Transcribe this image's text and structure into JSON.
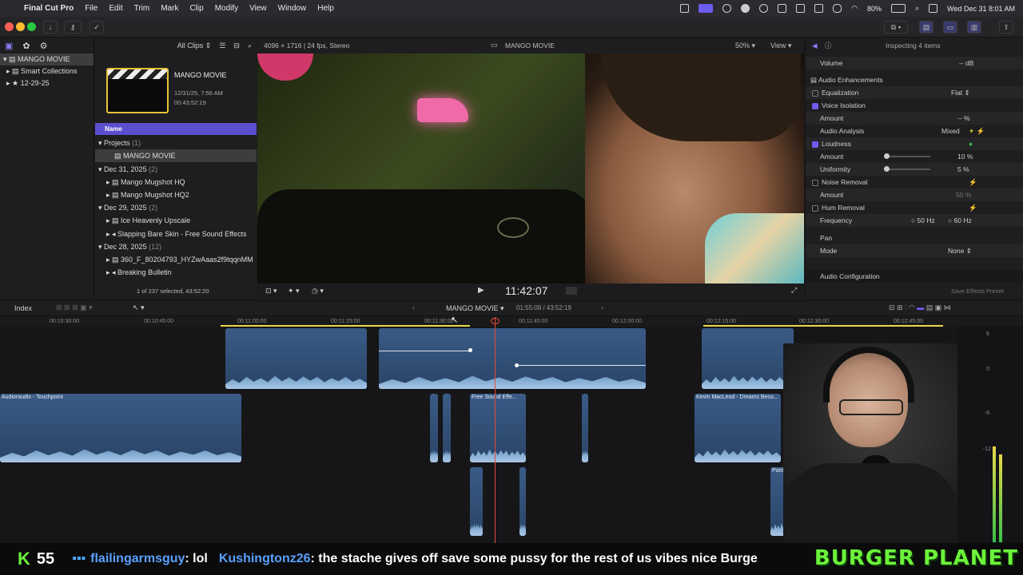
{
  "menubar": {
    "app_name": "Final Cut Pro",
    "items": [
      "File",
      "Edit",
      "Trim",
      "Mark",
      "Clip",
      "Modify",
      "View",
      "Window",
      "Help"
    ],
    "battery": "80%",
    "datetime": "Wed Dec 31  8:01 AM"
  },
  "browser": {
    "filter": "All Clips",
    "library_name": "MANGO MOVIE",
    "library_items": [
      "MANGO MOVIE",
      "Smart Collections",
      "12-29-25"
    ],
    "project_title": "MANGO MOVIE",
    "project_date": "12/31/25, 7:56 AM",
    "project_duration": "00:43:52:19",
    "column_name": "Name",
    "rows": [
      {
        "label": "Projects",
        "count": "(1)"
      },
      {
        "label": "MANGO MOVIE",
        "count": ""
      },
      {
        "label": "Dec 31, 2025",
        "count": "(2)"
      },
      {
        "label": "Mango Mugshot HQ",
        "count": ""
      },
      {
        "label": "Mango Mugshot HQ2",
        "count": ""
      },
      {
        "label": "Dec 29, 2025",
        "count": "(2)"
      },
      {
        "label": "Ice Heavenly Upscale",
        "count": ""
      },
      {
        "label": "Slapping Bare Skin - Free Sound Effects",
        "count": ""
      },
      {
        "label": "Dec 28, 2025",
        "count": "(12)"
      },
      {
        "label": "360_F_80204793_HYZwAaas2f9tqqnMM",
        "count": ""
      },
      {
        "label": "Breaking Bulletin",
        "count": ""
      }
    ],
    "selection_status": "1 of 237 selected, 43:52:20"
  },
  "viewer": {
    "format": "4096 × 1716 | 24 fps, Stereo",
    "title": "MANGO MOVIE",
    "zoom": "50%",
    "view_label": "View",
    "timecode": "11:42:07"
  },
  "inspector": {
    "header": "Inspecting 4 items",
    "volume_label": "Volume",
    "volume_value": "-- dB",
    "section": "Audio Enhancements",
    "equalization": {
      "label": "Equalization",
      "value": "Flat"
    },
    "voice_isolation": {
      "label": "Voice Isolation",
      "amount_label": "Amount",
      "amount_value": "-- %"
    },
    "audio_analysis": {
      "label": "Audio Analysis",
      "value": "Mixed"
    },
    "loudness": {
      "label": "Loudness",
      "amount_label": "Amount",
      "amount_value": "10",
      "amount_unit": "%",
      "uniformity_label": "Uniformity",
      "uniformity_value": "5",
      "uniformity_unit": "%",
      "amount_level": 0.1,
      "uniformity_level": 0.05
    },
    "noise_removal": {
      "label": "Noise Removal",
      "amount_label": "Amount",
      "amount_value": "50 %"
    },
    "hum_removal": {
      "label": "Hum Removal",
      "frequency_label": "Frequency",
      "freq_a": "50 Hz",
      "freq_b": "60 Hz"
    },
    "pan_label": "Pan",
    "mode_label": "Mode",
    "mode_value": "None",
    "audio_config": "Audio Configuration",
    "save_preset": "Save Effects Preset"
  },
  "timeline": {
    "index_label": "Index",
    "project_name": "MANGO MOVIE",
    "position": "01:55:08 / 43:52:19",
    "ruler_ticks": [
      "00:10:30:00",
      "00:10:45:00",
      "00:11:00:00",
      "00:11:15:00",
      "00:11:30:00",
      "00:11:45:00",
      "00:12:00:00",
      "00:12:15:00",
      "00:12:30:00",
      "00:12:45:00"
    ],
    "clip_labels": [
      "Audioraudix - Touchpoint",
      "Free Sound Effe...",
      "Kevin MacLeod - Dreams Beco...",
      "Patrick Patri"
    ],
    "meter_labels": [
      "6",
      "0",
      "-6",
      "-12"
    ]
  },
  "stream": {
    "counter_icon": "K",
    "counter_value": "55",
    "chat": [
      {
        "user": "flailingarmsguy",
        "message": ": lol",
        "user_color": "#5aa0ff"
      },
      {
        "user": "Kushingtonz26",
        "message": ": the stache gives off save some pussy for the rest of us vibes nice Burge",
        "user_color": "#5aa0ff"
      }
    ],
    "brand": "BURGER PLANET",
    "brand_color": "#6cf23a"
  },
  "colors": {
    "accent": "#6e5cf0",
    "playhead": "#e14a3a",
    "clip": "#3a5b86"
  }
}
